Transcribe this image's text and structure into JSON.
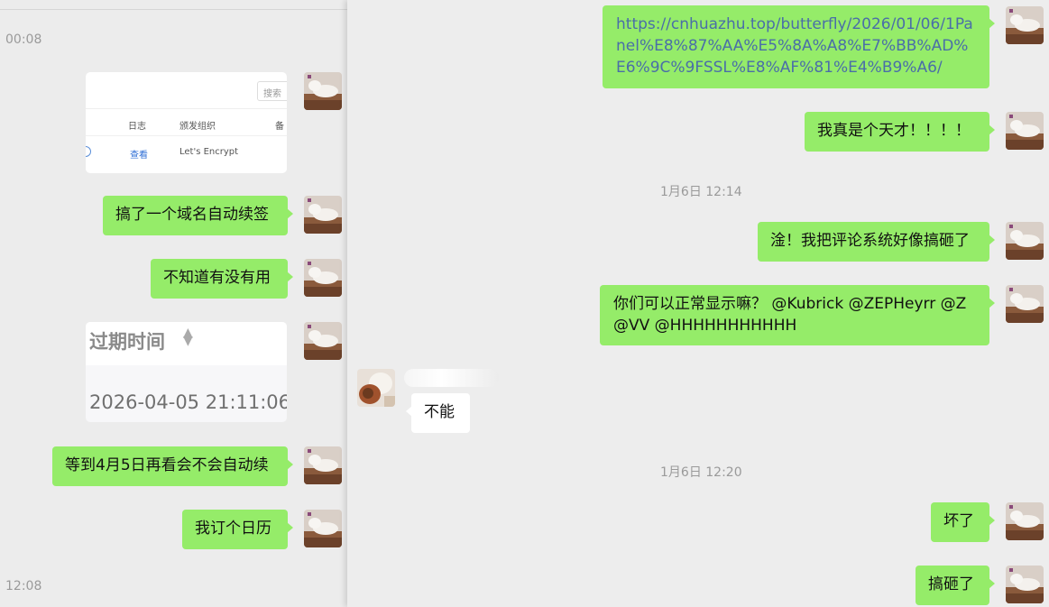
{
  "left": {
    "timestamps": [
      "00:08",
      "12:08"
    ],
    "screenshot1": {
      "search_placeholder": "搜索",
      "col_log": "日志",
      "col_issuer": "颁发组织",
      "col_cut": "备",
      "view_link": "查看",
      "issuer_value": "Let's Encrypt"
    },
    "screenshot2": {
      "header": "过期时间",
      "value": "2026-04-05 21:11:06"
    },
    "messages": [
      "搞了一个域名自动续签",
      "不知道有没有用",
      "等到4月5日再看会不会自动续",
      "我订个日历"
    ]
  },
  "right": {
    "url": "https://cnhuazhu.top/butterfly/2026/01/06/1Panel%E8%87%AA%E5%8A%A8%E7%BB%AD%E6%9C%9FSSL%E8%AF%81%E4%B9%A6/",
    "genius": "我真是个天才！！！！",
    "time1": "1月6日 12:14",
    "broke_comments": "淦！我把评论系统好像搞砸了",
    "question": "你们可以正常显示嘛？ @Kubrick  @ZEPHeyrr  @Z@VV  @HHHHHHHHHHH",
    "reply": "不能",
    "time2": "1月6日 12:20",
    "broken": "坏了",
    "screwed": "搞砸了"
  },
  "colors": {
    "self_bubble": "#95ec69",
    "other_bubble": "#ffffff",
    "background": "#ededed",
    "link": "#4a6ea8"
  }
}
